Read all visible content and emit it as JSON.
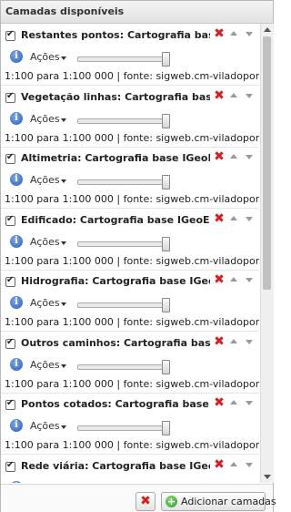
{
  "panel": {
    "title": "Camadas disponíveis"
  },
  "layers": [
    {
      "name": "Restantes pontos: Cartografia base IGeoE",
      "checked": true,
      "opacity_percent": 100,
      "actions_label": "Ações",
      "scale": "1:100 para 1:100 000",
      "separator": "|",
      "source": "fonte: sigweb.cm-viladoporto.pt"
    },
    {
      "name": "Vegetação linhas: Cartografia base IGeoE",
      "checked": true,
      "opacity_percent": 100,
      "actions_label": "Ações",
      "scale": "1:100 para 1:100 000",
      "separator": "|",
      "source": "fonte: sigweb.cm-viladoporto.pt"
    },
    {
      "name": "Altimetria: Cartografia base IGeoE",
      "checked": true,
      "opacity_percent": 100,
      "actions_label": "Ações",
      "scale": "1:100 para 1:100 000",
      "separator": "|",
      "source": "fonte: sigweb.cm-viladoporto.pt"
    },
    {
      "name": "Edificado: Cartografia base IGeoE",
      "checked": true,
      "opacity_percent": 100,
      "actions_label": "Ações",
      "scale": "1:100 para 1:100 000",
      "separator": "|",
      "source": "fonte: sigweb.cm-viladoporto.pt"
    },
    {
      "name": "Hidrografia: Cartografia base IGeoE",
      "checked": true,
      "opacity_percent": 100,
      "actions_label": "Ações",
      "scale": "1:100 para 1:100 000",
      "separator": "|",
      "source": "fonte: sigweb.cm-viladoporto.pt"
    },
    {
      "name": "Outros caminhos: Cartografia base IGeoE",
      "checked": true,
      "opacity_percent": 100,
      "actions_label": "Ações",
      "scale": "1:100 para 1:100 000",
      "separator": "|",
      "source": "fonte: sigweb.cm-viladoporto.pt"
    },
    {
      "name": "Pontos cotados: Cartografia base IGeoE",
      "checked": true,
      "opacity_percent": 100,
      "actions_label": "Ações",
      "scale": "1:100 para 1:100 000",
      "separator": "|",
      "source": "fonte: sigweb.cm-viladoporto.pt"
    },
    {
      "name": "Rede viária: Cartografia base IGeoE",
      "checked": true,
      "opacity_percent": 100,
      "actions_label": "Ações",
      "scale": "",
      "separator": "",
      "source": ""
    }
  ],
  "icons": {
    "delete": "delete-icon",
    "up": "move-up-icon",
    "down": "move-down-icon",
    "info": "info-icon",
    "add": "add-icon"
  },
  "colors": {
    "delete": "#d42020",
    "info": "#2c5fb5",
    "add": "#2e9a2a"
  },
  "footer": {
    "add_label": "Adicionar camadas"
  }
}
